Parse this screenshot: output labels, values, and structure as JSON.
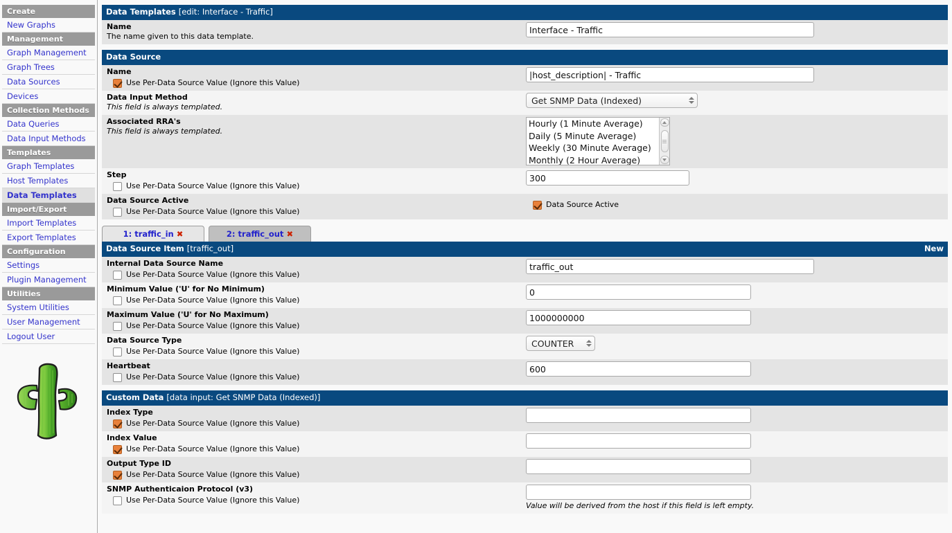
{
  "sidebar": {
    "sections": [
      {
        "header": "Create",
        "items": [
          "New Graphs"
        ]
      },
      {
        "header": "Management",
        "items": [
          "Graph Management",
          "Graph Trees",
          "Data Sources",
          "Devices"
        ]
      },
      {
        "header": "Collection Methods",
        "items": [
          "Data Queries",
          "Data Input Methods"
        ]
      },
      {
        "header": "Templates",
        "items": [
          "Graph Templates",
          "Host Templates",
          "Data Templates"
        ]
      },
      {
        "header": "Import/Export",
        "items": [
          "Import Templates",
          "Export Templates"
        ]
      },
      {
        "header": "Configuration",
        "items": [
          "Settings",
          "Plugin Management"
        ]
      },
      {
        "header": "Utilities",
        "items": [
          "System Utilities",
          "User Management",
          "Logout User"
        ]
      }
    ],
    "selected_item": "Data Templates",
    "logo_icon": "cactus-logo-icon"
  },
  "colors": {
    "header_blue": "#09497F",
    "nav_header_gray": "#9A9A9A",
    "link_blue": "#3333CC",
    "checked_orange": "#E8803A",
    "delete_red": "#CC2200",
    "row_dark": "#E4E4E4",
    "row_light": "#F4F4F4"
  },
  "common": {
    "per_ds_label": "Use Per-Data Source Value (Ignore this Value)"
  },
  "panels": {
    "data_templates": {
      "title": "Data Templates",
      "subtitle": "[edit: Interface - Traffic]",
      "fields": {
        "name": {
          "label": "Name",
          "desc": "The name given to this data template.",
          "value": "Interface - Traffic"
        }
      }
    },
    "data_source": {
      "title": "Data Source",
      "subtitle": "",
      "fields": {
        "name": {
          "label": "Name",
          "checkbox_checked": true,
          "value": "|host_description| - Traffic"
        },
        "data_input_method": {
          "label": "Data Input Method",
          "desc": "This field is always templated.",
          "value": "Get SNMP Data (Indexed)"
        },
        "associated_rras": {
          "label": "Associated RRA's",
          "desc": "This field is always templated.",
          "options": [
            "Hourly (1 Minute Average)",
            "Daily (5 Minute Average)",
            "Weekly (30 Minute Average)",
            "Monthly (2 Hour Average)"
          ],
          "selected": "Hourly (1 Minute Average)"
        },
        "step": {
          "label": "Step",
          "checkbox_checked": false,
          "value": "300"
        },
        "data_source_active": {
          "label": "Data Source Active",
          "checkbox_checked": false,
          "active_checkbox_label": "Data Source Active",
          "active_checked": true
        }
      }
    },
    "tabs": [
      {
        "label": "1: traffic_in",
        "close": "✖",
        "active": false
      },
      {
        "label": "2: traffic_out",
        "close": "✖",
        "active": true
      }
    ],
    "data_source_item": {
      "title": "Data Source Item",
      "subtitle": "[traffic_out]",
      "action_link": "New",
      "fields": {
        "internal_name": {
          "label": "Internal Data Source Name",
          "checkbox_checked": false,
          "value": "traffic_out"
        },
        "minimum_value": {
          "label": "Minimum Value ('U' for No Minimum)",
          "checkbox_checked": false,
          "value": "0"
        },
        "maximum_value": {
          "label": "Maximum Value ('U' for No Maximum)",
          "checkbox_checked": false,
          "value": "1000000000"
        },
        "data_source_type": {
          "label": "Data Source Type",
          "checkbox_checked": false,
          "value": "COUNTER"
        },
        "heartbeat": {
          "label": "Heartbeat",
          "checkbox_checked": false,
          "value": "600"
        }
      }
    },
    "custom_data": {
      "title": "Custom Data",
      "subtitle": "[data input: Get SNMP Data (Indexed)]",
      "fields": {
        "index_type": {
          "label": "Index Type",
          "checkbox_checked": true,
          "value": ""
        },
        "index_value": {
          "label": "Index Value",
          "checkbox_checked": true,
          "value": ""
        },
        "output_type_id": {
          "label": "Output Type ID",
          "checkbox_checked": true,
          "value": ""
        },
        "snmp_auth_protocol": {
          "label": "SNMP Authenticaion Protocol (v3)",
          "checkbox_checked": false,
          "value": "",
          "hint": "Value will be derived from the host if this field is left empty."
        }
      }
    }
  }
}
